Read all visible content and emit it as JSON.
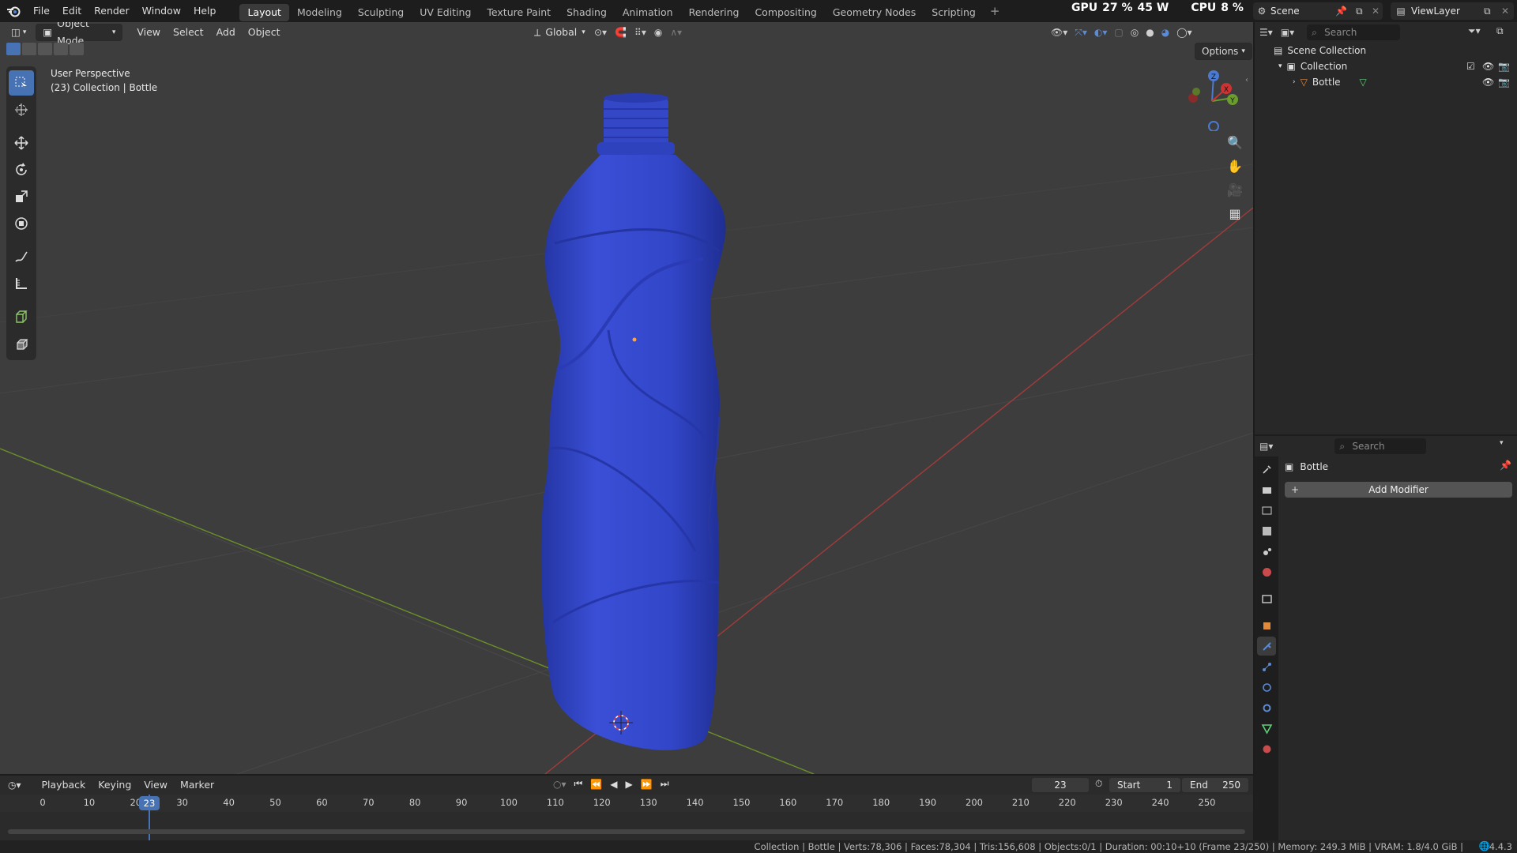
{
  "topbar": {
    "menus": [
      "File",
      "Edit",
      "Render",
      "Window",
      "Help"
    ],
    "workspaces": [
      "Layout",
      "Modeling",
      "Sculpting",
      "UV Editing",
      "Texture Paint",
      "Shading",
      "Animation",
      "Rendering",
      "Compositing",
      "Geometry Nodes",
      "Scripting"
    ],
    "active_workspace": "Layout",
    "add_workspace": "+",
    "gpu_label": "GPU",
    "gpu_value": "27 %",
    "gpu_power": "45 W",
    "cpu_label": "CPU",
    "cpu_value": "8 %",
    "scene_name": "Scene",
    "view_layer": "ViewLayer"
  },
  "viewport_header": {
    "mode": "Object Mode",
    "menus": [
      "View",
      "Select",
      "Add",
      "Object"
    ],
    "orientation": "Global",
    "options": "Options"
  },
  "viewport_overlay": {
    "perspective": "User Perspective",
    "context": "(23) Collection | Bottle",
    "gizmo_z": "Z",
    "gizmo_y": "Y",
    "gizmo_x": "X"
  },
  "outliner": {
    "search_placeholder": "Search",
    "scene_collection": "Scene Collection",
    "collection": "Collection",
    "object": "Bottle"
  },
  "properties": {
    "search_placeholder": "Search",
    "object_name": "Bottle",
    "add_modifier": "Add Modifier"
  },
  "timeline": {
    "menus": [
      "Playback",
      "Keying",
      "View",
      "Marker"
    ],
    "current_frame": "23",
    "start_label": "Start",
    "start_value": "1",
    "end_label": "End",
    "end_value": "250",
    "ticks": [
      "0",
      "10",
      "20",
      "30",
      "40",
      "50",
      "60",
      "70",
      "80",
      "90",
      "100",
      "110",
      "120",
      "130",
      "140",
      "150",
      "160",
      "170",
      "180",
      "190",
      "200",
      "210",
      "220",
      "230",
      "240",
      "250"
    ]
  },
  "statusbar": {
    "text": "Collection | Bottle | Verts:78,306 | Faces:78,304 | Tris:156,608 | Objects:0/1 | Duration: 00:10+10 (Frame 23/250) | Memory: 249.3 MiB | VRAM: 1.8/4.0 GiB |",
    "version": "4.4.3"
  },
  "colors": {
    "accent": "#4772b3",
    "bottle": "#3346c9",
    "x_axis": "#a23b3b",
    "y_axis": "#6b8f2a"
  }
}
